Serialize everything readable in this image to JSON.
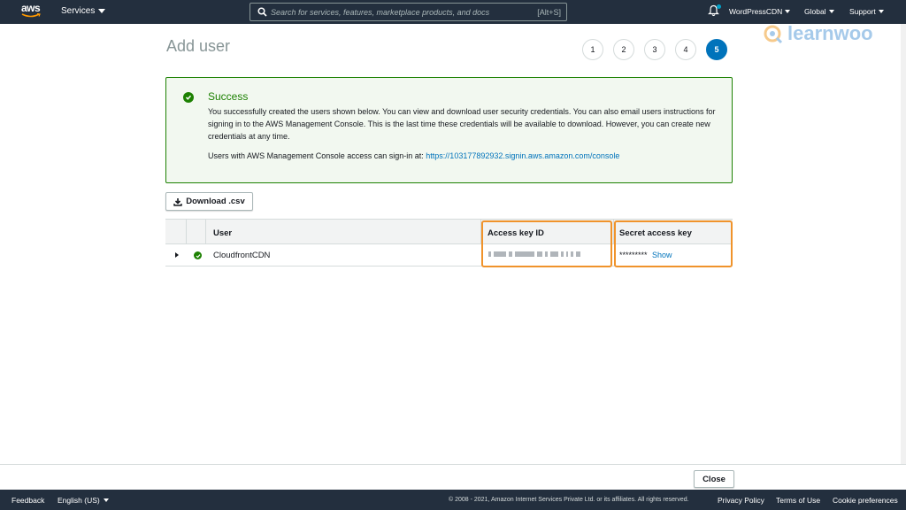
{
  "nav": {
    "logo_text": "aws",
    "services_label": "Services",
    "search_placeholder": "Search for services, features, marketplace products, and docs",
    "search_shortcut": "[Alt+S]",
    "account_label": "WordPressCDN",
    "region_label": "Global",
    "support_label": "Support"
  },
  "watermark": {
    "text": "learnwoo"
  },
  "page": {
    "title": "Add user",
    "steps": [
      "1",
      "2",
      "3",
      "4",
      "5"
    ],
    "active_step": "5"
  },
  "success": {
    "title": "Success",
    "body": "You successfully created the users shown below. You can view and download user security credentials. You can also email users instructions for signing in to the AWS Management Console. This is the last time these credentials will be available to download. However, you can create new credentials at any time.",
    "signin_text": "Users with AWS Management Console access can sign-in at:",
    "signin_url": "https://103177892932.signin.aws.amazon.com/console"
  },
  "download_label": "Download .csv",
  "table": {
    "headers": {
      "user": "User",
      "access_key": "Access key ID",
      "secret_key": "Secret access key"
    },
    "rows": [
      {
        "user": "CloudfrontCDN",
        "secret_mask": "*********",
        "show_label": "Show"
      }
    ]
  },
  "close_label": "Close",
  "footer": {
    "feedback": "Feedback",
    "language": "English (US)",
    "copyright": "© 2008 - 2021, Amazon Internet Services Private Ltd. or its affiliates. All rights reserved.",
    "privacy": "Privacy Policy",
    "terms": "Terms of Use",
    "cookies": "Cookie preferences"
  },
  "colors": {
    "nav_bg": "#232f3e",
    "success_green": "#1d8102",
    "link_blue": "#0073bb",
    "highlight_orange": "#f0932b"
  }
}
